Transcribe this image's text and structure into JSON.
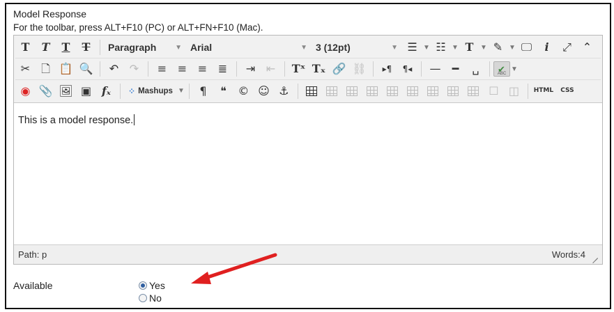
{
  "field": {
    "label": "Model Response",
    "hint": "For the toolbar, press ALT+F10 (PC) or ALT+FN+F10 (Mac)."
  },
  "toolbar": {
    "paragraph": "Paragraph",
    "font": "Arial",
    "size": "3 (12pt)",
    "mashups": "Mashups",
    "html_label": "HTML",
    "css_label": "CSS"
  },
  "editor": {
    "content": "This is a model response."
  },
  "status": {
    "path_label": "Path:",
    "path_value": "p",
    "words": "Words:4"
  },
  "available": {
    "label": "Available",
    "options": [
      {
        "label": "Yes",
        "selected": true
      },
      {
        "label": "No",
        "selected": false
      }
    ]
  },
  "colors": {
    "annotation_arrow": "#e02020",
    "radio_selected": "#2f5fa0"
  }
}
